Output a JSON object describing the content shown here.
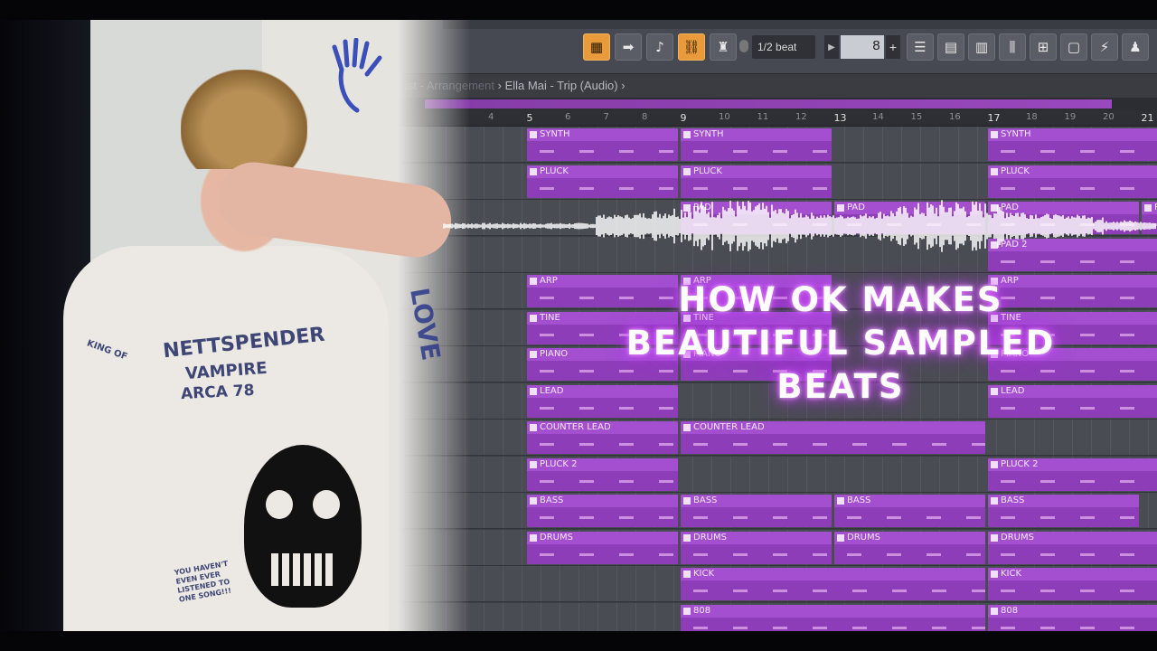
{
  "toolbar": {
    "snap_label": "1/2 beat",
    "snap_value": "8",
    "plus_label": "+",
    "buttons": [
      "piano-icon",
      "arrow-right-icon",
      "curve-icon",
      "link-icon",
      "stamp-icon"
    ],
    "right_buttons": [
      "mixer-icon",
      "playlist-icon",
      "channel-icon",
      "eq-icon",
      "browser-icon",
      "file-icon",
      "plugin-icon",
      "person-icon"
    ]
  },
  "breadcrumb": {
    "faded": "ist - Arrangement",
    "sep1": "›",
    "item": "Ella Mai - Trip (Audio)",
    "sep2": "›"
  },
  "ruler": {
    "labels": [
      {
        "text": "4",
        "major": false
      },
      {
        "text": "5",
        "major": true
      },
      {
        "text": "6",
        "major": false
      },
      {
        "text": "7",
        "major": false
      },
      {
        "text": "8",
        "major": false
      },
      {
        "text": "9",
        "major": true
      },
      {
        "text": "10",
        "major": false
      },
      {
        "text": "11",
        "major": false
      },
      {
        "text": "12",
        "major": false
      },
      {
        "text": "13",
        "major": true
      },
      {
        "text": "14",
        "major": false
      },
      {
        "text": "15",
        "major": false
      },
      {
        "text": "16",
        "major": false
      },
      {
        "text": "17",
        "major": true
      },
      {
        "text": "18",
        "major": false
      },
      {
        "text": "19",
        "major": false
      },
      {
        "text": "20",
        "major": false
      },
      {
        "text": "21",
        "major": true
      }
    ]
  },
  "tracks": [
    {
      "clips": [
        {
          "label": "SYNTH",
          "start": 0,
          "end": 4
        },
        {
          "label": "SYNTH",
          "start": 4,
          "end": 8
        },
        {
          "label": "SYNTH",
          "start": 12,
          "end": 17
        }
      ]
    },
    {
      "clips": [
        {
          "label": "PLUCK",
          "start": 0,
          "end": 4
        },
        {
          "label": "PLUCK",
          "start": 4,
          "end": 8
        },
        {
          "label": "PLUCK",
          "start": 12,
          "end": 17
        }
      ]
    },
    {
      "clips": [
        {
          "label": "PAD",
          "start": 4,
          "end": 8
        },
        {
          "label": "PAD",
          "start": 8,
          "end": 12
        },
        {
          "label": "PAD",
          "start": 12,
          "end": 16
        },
        {
          "label": "PAD",
          "start": 16,
          "end": 17
        }
      ]
    },
    {
      "clips": [
        {
          "label": "PAD 2",
          "start": 12,
          "end": 17
        }
      ]
    },
    {
      "clips": [
        {
          "label": "ARP",
          "start": 0,
          "end": 4
        },
        {
          "label": "ARP",
          "start": 4,
          "end": 8
        },
        {
          "label": "ARP",
          "start": 12,
          "end": 17
        }
      ]
    },
    {
      "clips": [
        {
          "label": "TINE",
          "start": 0,
          "end": 4
        },
        {
          "label": "TINE",
          "start": 4,
          "end": 8
        },
        {
          "label": "TINE",
          "start": 12,
          "end": 17
        }
      ]
    },
    {
      "clips": [
        {
          "label": "PIANO",
          "start": 0,
          "end": 4
        },
        {
          "label": "PIANO",
          "start": 4,
          "end": 8
        },
        {
          "label": "PIANO",
          "start": 12,
          "end": 17
        }
      ]
    },
    {
      "clips": [
        {
          "label": "LEAD",
          "start": 0,
          "end": 4
        },
        {
          "label": "LEAD",
          "start": 12,
          "end": 17
        }
      ]
    },
    {
      "clips": [
        {
          "label": "COUNTER LEAD",
          "start": 0,
          "end": 4
        },
        {
          "label": "COUNTER LEAD",
          "start": 4,
          "end": 12
        }
      ]
    },
    {
      "clips": [
        {
          "label": "PLUCK 2",
          "start": 0,
          "end": 4
        },
        {
          "label": "PLUCK 2",
          "start": 12,
          "end": 17
        }
      ]
    },
    {
      "clips": [
        {
          "label": "BASS",
          "start": 0,
          "end": 4
        },
        {
          "label": "BASS",
          "start": 4,
          "end": 8
        },
        {
          "label": "BASS",
          "start": 8,
          "end": 12
        },
        {
          "label": "BASS",
          "start": 12,
          "end": 16
        }
      ]
    },
    {
      "clips": [
        {
          "label": "DRUMS",
          "start": 0,
          "end": 4
        },
        {
          "label": "DRUMS",
          "start": 4,
          "end": 8
        },
        {
          "label": "DRUMS",
          "start": 8,
          "end": 12
        },
        {
          "label": "DRUMS",
          "start": 12,
          "end": 17
        }
      ]
    },
    {
      "clips": [
        {
          "label": "KICK",
          "start": 4,
          "end": 12
        },
        {
          "label": "KICK",
          "start": 12,
          "end": 17
        }
      ]
    },
    {
      "clips": [
        {
          "label": "808",
          "start": 4,
          "end": 12
        },
        {
          "label": "808",
          "start": 12,
          "end": 17
        }
      ]
    }
  ],
  "photo": {
    "scribbles": [
      "NETTSPENDER",
      "VAMPIRE",
      "ARCA 78",
      "YOU HAVEN'T EVEN EVER LISTENED TO ONE SONG!!!",
      "KING OF",
      "LOVE"
    ]
  },
  "title": {
    "line1": "HOW OK MAKES",
    "line2": "BEAUTIFUL SAMPLED",
    "line3": "BEATS"
  },
  "colors": {
    "clip": "#8e3db8",
    "clip_head": "#a34fd0",
    "accent_orange": "#e99a3a",
    "glow": "#e05cff"
  }
}
